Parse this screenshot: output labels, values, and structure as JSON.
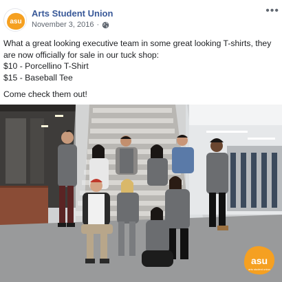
{
  "post": {
    "page_name": "Arts Student Union",
    "date": "November 3, 2016",
    "separator": "·",
    "privacy_icon": "globe-icon",
    "menu_icon": "more-options-icon",
    "menu_glyph": "•••",
    "avatar_logo_text": "asu",
    "text_lines": [
      "What a great looking executive team in some great looking T-shirts, they are now officially for sale in our tuck shop:",
      "$10 - Porcellino T-Shirt",
      "$15 - Baseball Tee"
    ],
    "closing_line": "Come check them out!"
  },
  "photo": {
    "watermark_text": "asu",
    "watermark_subtext": "arts student union"
  },
  "colors": {
    "link": "#385898",
    "meta": "#606770",
    "logo_orange": "#f5a021",
    "shirt_grey": "#6b6d70"
  }
}
